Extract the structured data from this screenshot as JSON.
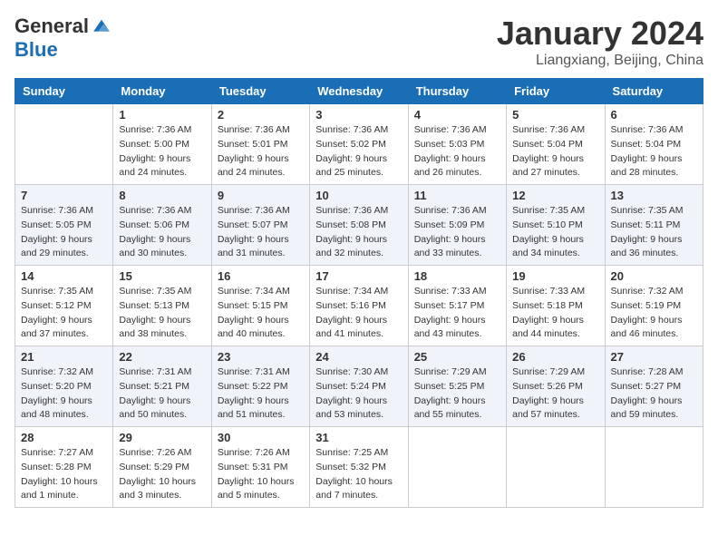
{
  "logo": {
    "general": "General",
    "blue": "Blue"
  },
  "title": "January 2024",
  "location": "Liangxiang, Beijing, China",
  "days_of_week": [
    "Sunday",
    "Monday",
    "Tuesday",
    "Wednesday",
    "Thursday",
    "Friday",
    "Saturday"
  ],
  "weeks": [
    [
      {
        "day": "",
        "sunrise": "",
        "sunset": "",
        "daylight": ""
      },
      {
        "day": "1",
        "sunrise": "Sunrise: 7:36 AM",
        "sunset": "Sunset: 5:00 PM",
        "daylight": "Daylight: 9 hours and 24 minutes."
      },
      {
        "day": "2",
        "sunrise": "Sunrise: 7:36 AM",
        "sunset": "Sunset: 5:01 PM",
        "daylight": "Daylight: 9 hours and 24 minutes."
      },
      {
        "day": "3",
        "sunrise": "Sunrise: 7:36 AM",
        "sunset": "Sunset: 5:02 PM",
        "daylight": "Daylight: 9 hours and 25 minutes."
      },
      {
        "day": "4",
        "sunrise": "Sunrise: 7:36 AM",
        "sunset": "Sunset: 5:03 PM",
        "daylight": "Daylight: 9 hours and 26 minutes."
      },
      {
        "day": "5",
        "sunrise": "Sunrise: 7:36 AM",
        "sunset": "Sunset: 5:04 PM",
        "daylight": "Daylight: 9 hours and 27 minutes."
      },
      {
        "day": "6",
        "sunrise": "Sunrise: 7:36 AM",
        "sunset": "Sunset: 5:04 PM",
        "daylight": "Daylight: 9 hours and 28 minutes."
      }
    ],
    [
      {
        "day": "7",
        "sunrise": "Sunrise: 7:36 AM",
        "sunset": "Sunset: 5:05 PM",
        "daylight": "Daylight: 9 hours and 29 minutes."
      },
      {
        "day": "8",
        "sunrise": "Sunrise: 7:36 AM",
        "sunset": "Sunset: 5:06 PM",
        "daylight": "Daylight: 9 hours and 30 minutes."
      },
      {
        "day": "9",
        "sunrise": "Sunrise: 7:36 AM",
        "sunset": "Sunset: 5:07 PM",
        "daylight": "Daylight: 9 hours and 31 minutes."
      },
      {
        "day": "10",
        "sunrise": "Sunrise: 7:36 AM",
        "sunset": "Sunset: 5:08 PM",
        "daylight": "Daylight: 9 hours and 32 minutes."
      },
      {
        "day": "11",
        "sunrise": "Sunrise: 7:36 AM",
        "sunset": "Sunset: 5:09 PM",
        "daylight": "Daylight: 9 hours and 33 minutes."
      },
      {
        "day": "12",
        "sunrise": "Sunrise: 7:35 AM",
        "sunset": "Sunset: 5:10 PM",
        "daylight": "Daylight: 9 hours and 34 minutes."
      },
      {
        "day": "13",
        "sunrise": "Sunrise: 7:35 AM",
        "sunset": "Sunset: 5:11 PM",
        "daylight": "Daylight: 9 hours and 36 minutes."
      }
    ],
    [
      {
        "day": "14",
        "sunrise": "Sunrise: 7:35 AM",
        "sunset": "Sunset: 5:12 PM",
        "daylight": "Daylight: 9 hours and 37 minutes."
      },
      {
        "day": "15",
        "sunrise": "Sunrise: 7:35 AM",
        "sunset": "Sunset: 5:13 PM",
        "daylight": "Daylight: 9 hours and 38 minutes."
      },
      {
        "day": "16",
        "sunrise": "Sunrise: 7:34 AM",
        "sunset": "Sunset: 5:15 PM",
        "daylight": "Daylight: 9 hours and 40 minutes."
      },
      {
        "day": "17",
        "sunrise": "Sunrise: 7:34 AM",
        "sunset": "Sunset: 5:16 PM",
        "daylight": "Daylight: 9 hours and 41 minutes."
      },
      {
        "day": "18",
        "sunrise": "Sunrise: 7:33 AM",
        "sunset": "Sunset: 5:17 PM",
        "daylight": "Daylight: 9 hours and 43 minutes."
      },
      {
        "day": "19",
        "sunrise": "Sunrise: 7:33 AM",
        "sunset": "Sunset: 5:18 PM",
        "daylight": "Daylight: 9 hours and 44 minutes."
      },
      {
        "day": "20",
        "sunrise": "Sunrise: 7:32 AM",
        "sunset": "Sunset: 5:19 PM",
        "daylight": "Daylight: 9 hours and 46 minutes."
      }
    ],
    [
      {
        "day": "21",
        "sunrise": "Sunrise: 7:32 AM",
        "sunset": "Sunset: 5:20 PM",
        "daylight": "Daylight: 9 hours and 48 minutes."
      },
      {
        "day": "22",
        "sunrise": "Sunrise: 7:31 AM",
        "sunset": "Sunset: 5:21 PM",
        "daylight": "Daylight: 9 hours and 50 minutes."
      },
      {
        "day": "23",
        "sunrise": "Sunrise: 7:31 AM",
        "sunset": "Sunset: 5:22 PM",
        "daylight": "Daylight: 9 hours and 51 minutes."
      },
      {
        "day": "24",
        "sunrise": "Sunrise: 7:30 AM",
        "sunset": "Sunset: 5:24 PM",
        "daylight": "Daylight: 9 hours and 53 minutes."
      },
      {
        "day": "25",
        "sunrise": "Sunrise: 7:29 AM",
        "sunset": "Sunset: 5:25 PM",
        "daylight": "Daylight: 9 hours and 55 minutes."
      },
      {
        "day": "26",
        "sunrise": "Sunrise: 7:29 AM",
        "sunset": "Sunset: 5:26 PM",
        "daylight": "Daylight: 9 hours and 57 minutes."
      },
      {
        "day": "27",
        "sunrise": "Sunrise: 7:28 AM",
        "sunset": "Sunset: 5:27 PM",
        "daylight": "Daylight: 9 hours and 59 minutes."
      }
    ],
    [
      {
        "day": "28",
        "sunrise": "Sunrise: 7:27 AM",
        "sunset": "Sunset: 5:28 PM",
        "daylight": "Daylight: 10 hours and 1 minute."
      },
      {
        "day": "29",
        "sunrise": "Sunrise: 7:26 AM",
        "sunset": "Sunset: 5:29 PM",
        "daylight": "Daylight: 10 hours and 3 minutes."
      },
      {
        "day": "30",
        "sunrise": "Sunrise: 7:26 AM",
        "sunset": "Sunset: 5:31 PM",
        "daylight": "Daylight: 10 hours and 5 minutes."
      },
      {
        "day": "31",
        "sunrise": "Sunrise: 7:25 AM",
        "sunset": "Sunset: 5:32 PM",
        "daylight": "Daylight: 10 hours and 7 minutes."
      },
      {
        "day": "",
        "sunrise": "",
        "sunset": "",
        "daylight": ""
      },
      {
        "day": "",
        "sunrise": "",
        "sunset": "",
        "daylight": ""
      },
      {
        "day": "",
        "sunrise": "",
        "sunset": "",
        "daylight": ""
      }
    ]
  ]
}
